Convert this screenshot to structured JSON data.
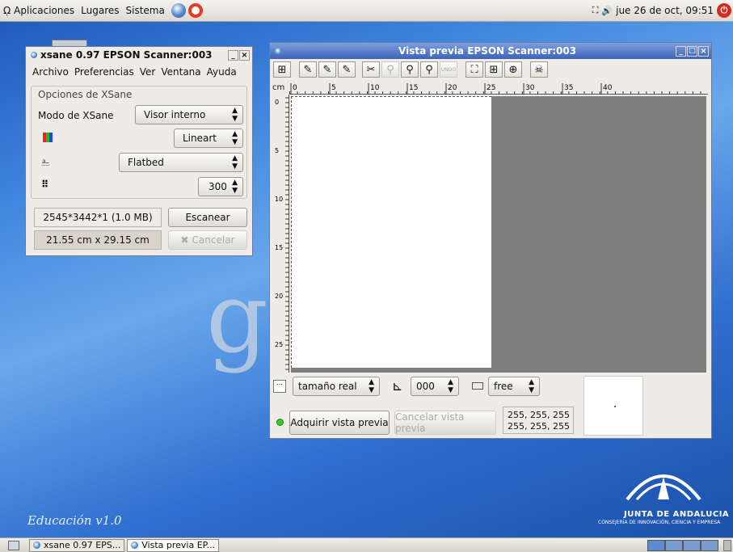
{
  "top_panel": {
    "menus": [
      "Aplicaciones",
      "Lugares",
      "Sistema"
    ],
    "clock": "jue 26 de oct, 09:51"
  },
  "xsane": {
    "title": "xsane 0.97 EPSON Scanner:003",
    "menubar": [
      "Archivo",
      "Preferencias",
      "Ver",
      "Ventana",
      "Ayuda"
    ],
    "group_label": "Opciones de XSane",
    "mode_label": "Modo de XSane",
    "mode_value": "Visor interno",
    "color_value": "Lineart",
    "source_value": "Flatbed",
    "resolution_value": "300",
    "image_size": "2545*3442*1 (1.0 MB)",
    "scan_button": "Escanear",
    "dimensions": "21.55 cm x 29.15 cm",
    "cancel_button": "Cancelar"
  },
  "preview": {
    "title": "Vista previa EPSON Scanner:003",
    "ruler_unit": "cm",
    "hruler_labels": [
      "0",
      "5",
      "10",
      "15",
      "20",
      "25",
      "30",
      "35",
      "40"
    ],
    "vruler_labels": [
      "0",
      "5",
      "10",
      "15",
      "20",
      "25"
    ],
    "zoom_value": "tamaño real",
    "rotation_value": "000",
    "ratio_value": "free",
    "acquire_button": "Adquirir vista previa",
    "cancel_preview_button": "Cancelar vista previa",
    "rgb_line1": "255, 255, 255",
    "rgb_line2": "255, 255, 255",
    "undo_label": "UNDO"
  },
  "desktop": {
    "brand_text": "Educación v1.0",
    "junta_title": "JUNTA DE ANDALUCIA",
    "junta_subtitle": "CONSEJERÍA DE INNOVACIÓN, CIENCIA Y EMPRESA"
  },
  "taskbar": {
    "items": [
      "xsane 0.97 EPS...",
      "Vista previa EP..."
    ]
  }
}
